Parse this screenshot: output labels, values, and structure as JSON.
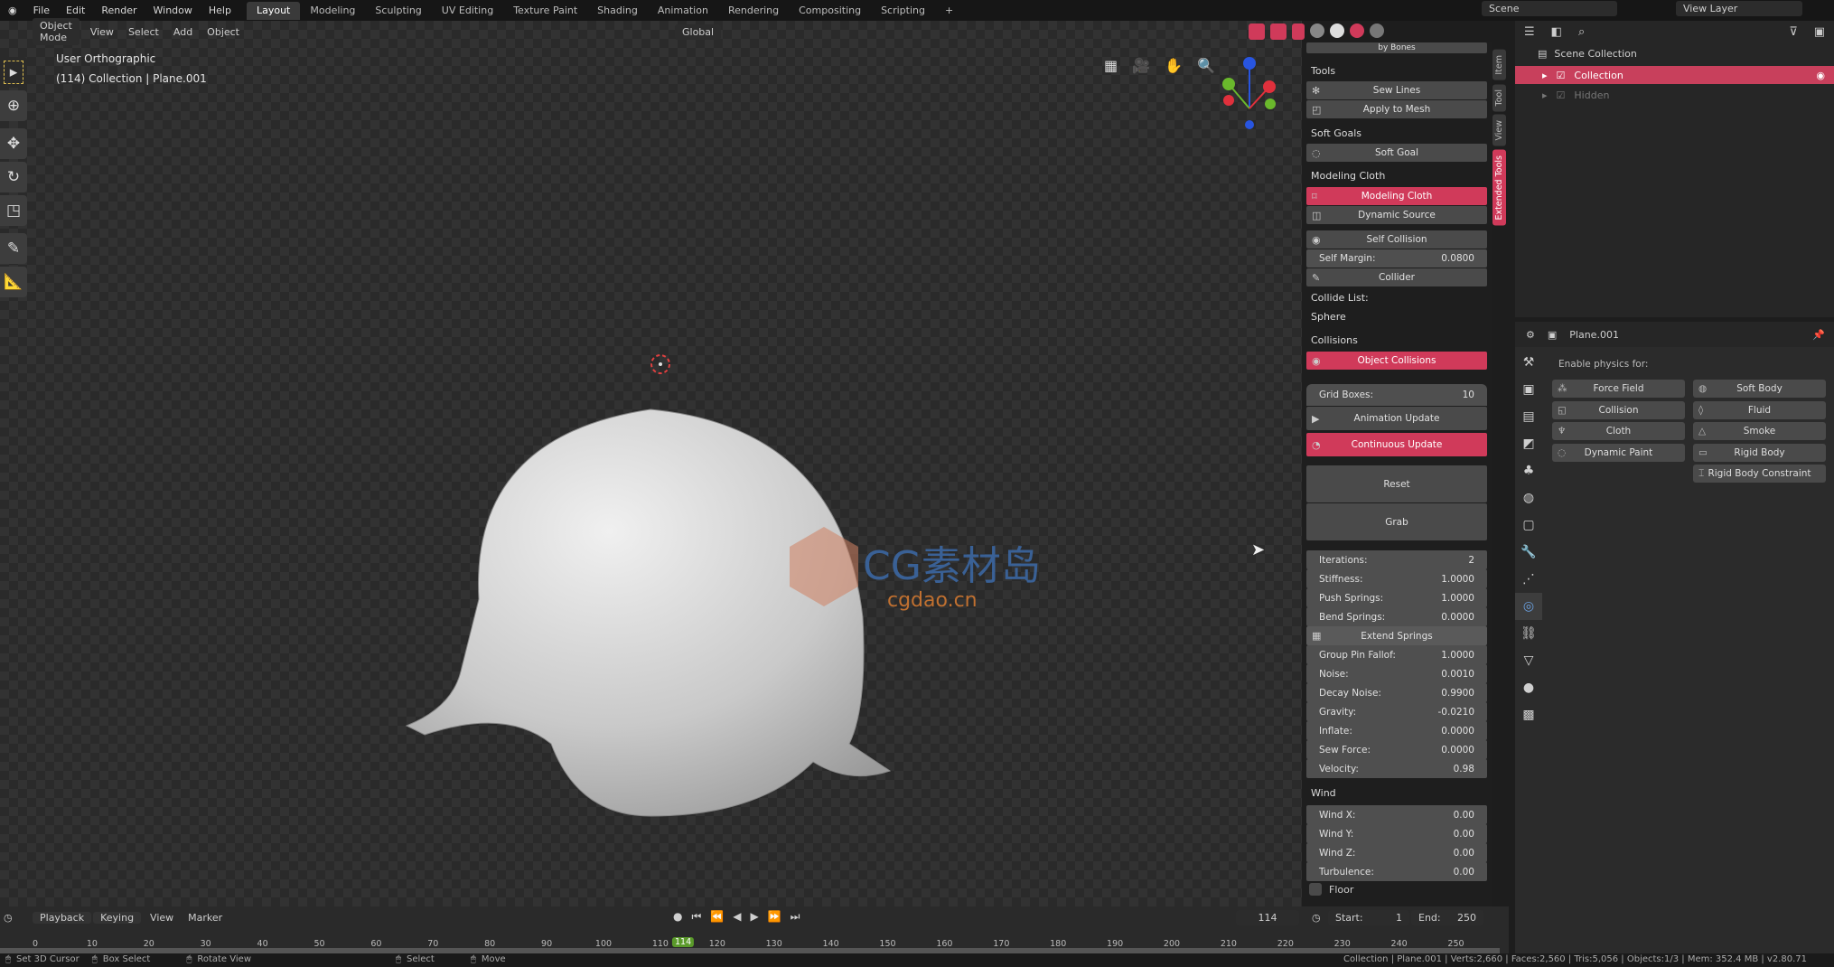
{
  "topbar": {
    "menus": [
      "File",
      "Edit",
      "Render",
      "Window",
      "Help"
    ],
    "workspaces": [
      "Layout",
      "Modeling",
      "Sculpting",
      "UV Editing",
      "Texture Paint",
      "Shading",
      "Animation",
      "Rendering",
      "Compositing",
      "Scripting"
    ],
    "active_workspace": "Layout",
    "add": "+",
    "scene": "Scene",
    "view_layer": "View Layer"
  },
  "header": {
    "mode": "Object Mode",
    "menus": [
      "View",
      "Select",
      "Add",
      "Object"
    ],
    "orientation": "Global"
  },
  "viewport": {
    "view_name": "User Orthographic",
    "object_info": "(114) Collection | Plane.001",
    "watermark": {
      "brand": "CG素材岛",
      "url": "cgdao.cn"
    },
    "colors": {
      "accent": "#d03a5a",
      "x_axis": "#e0303c",
      "y_axis": "#6ab82c",
      "z_axis": "#2855e0"
    }
  },
  "toolbar": {
    "tools": [
      "select-box",
      "cursor",
      "move",
      "rotate",
      "scale",
      "annotate",
      "measure"
    ]
  },
  "npanel": {
    "cut_label": "by Bones",
    "tools_label": "Tools",
    "sew_lines": "Sew Lines",
    "apply_to_mesh": "Apply to Mesh",
    "soft_goals_label": "Soft Goals",
    "soft_goal": "Soft Goal",
    "modeling_cloth_label": "Modeling Cloth",
    "modeling_cloth": "Modeling Cloth",
    "dynamic_source": "Dynamic Source",
    "self_collision": "Self Collision",
    "self_margin_label": "Self Margin:",
    "self_margin": "0.0800",
    "collider": "Collider",
    "collide_list_label": "Collide List:",
    "collide_item": "Sphere",
    "collisions_label": "Collisions",
    "object_collisions": "Object Collisions",
    "grid_boxes_label": "Grid Boxes:",
    "grid_boxes": "10",
    "animation_update": "Animation Update",
    "continuous_update": "Continuous Update",
    "reset": "Reset",
    "grab": "Grab",
    "params": [
      {
        "label": "Iterations:",
        "value": "2"
      },
      {
        "label": "Stiffness:",
        "value": "1.0000"
      },
      {
        "label": "Push Springs:",
        "value": "1.0000"
      },
      {
        "label": "Bend Springs:",
        "value": "0.0000"
      }
    ],
    "extend_springs": "Extend Springs",
    "params2": [
      {
        "label": "Group Pin Fallof:",
        "value": "1.0000"
      },
      {
        "label": "Noise:",
        "value": "0.0010"
      },
      {
        "label": "Decay Noise:",
        "value": "0.9900"
      },
      {
        "label": "Gravity:",
        "value": "-0.0210"
      },
      {
        "label": "Inflate:",
        "value": "0.0000"
      },
      {
        "label": "Sew Force:",
        "value": "0.0000"
      },
      {
        "label": "Velocity:",
        "value": "0.98"
      }
    ],
    "wind_label": "Wind",
    "wind": [
      {
        "label": "Wind X:",
        "value": "0.00"
      },
      {
        "label": "Wind Y:",
        "value": "0.00"
      },
      {
        "label": "Wind Z:",
        "value": "0.00"
      },
      {
        "label": "Turbulence:",
        "value": "0.00"
      }
    ],
    "floor": "Floor",
    "tabs": [
      "Item",
      "Tool",
      "View",
      "Extended Tools"
    ]
  },
  "outliner": {
    "scene_collection": "Scene Collection",
    "items": [
      {
        "name": "Collection",
        "selected": true
      },
      {
        "name": "Hidden",
        "selected": false
      }
    ]
  },
  "properties": {
    "object": "Plane.001",
    "enable_label": "Enable physics for:",
    "left": [
      "Force Field",
      "Collision",
      "Cloth",
      "Dynamic Paint"
    ],
    "right": [
      "Soft Body",
      "Fluid",
      "Smoke",
      "Rigid Body",
      "Rigid Body Constraint"
    ]
  },
  "timeline": {
    "menus": [
      "Playback",
      "Keying",
      "View",
      "Marker"
    ],
    "current_frame": "114",
    "start_label": "Start:",
    "start": "1",
    "end_label": "End:",
    "end": "250",
    "ticks": [
      "0",
      "10",
      "20",
      "30",
      "40",
      "50",
      "60",
      "70",
      "80",
      "90",
      "100",
      "110",
      "120",
      "130",
      "140",
      "150",
      "160",
      "170",
      "180",
      "190",
      "200",
      "210",
      "220",
      "230",
      "240",
      "250"
    ]
  },
  "status": {
    "left": [
      "Set 3D Cursor",
      "Box Select",
      "Rotate View",
      "Select",
      "Move"
    ],
    "right": "Collection | Plane.001 | Verts:2,660 | Faces:2,560 | Tris:5,056 | Objects:1/3 | Mem: 352.4 MB | v2.80.71"
  }
}
